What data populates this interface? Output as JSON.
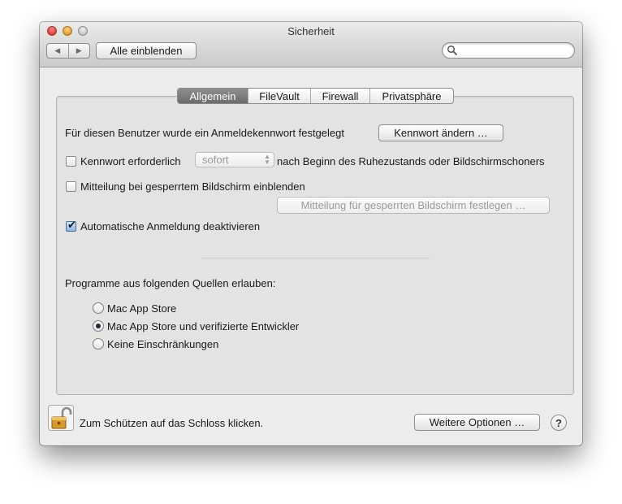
{
  "window": {
    "title": "Sicherheit",
    "show_all_label": "Alle einblenden",
    "search_placeholder": ""
  },
  "tabs": [
    {
      "label": "Allgemein",
      "active": true
    },
    {
      "label": "FileVault",
      "active": false
    },
    {
      "label": "Firewall",
      "active": false
    },
    {
      "label": "Privatsphäre",
      "active": false
    }
  ],
  "general": {
    "password_set_text": "Für diesen Benutzer wurde ein Anmeldekennwort festgelegt",
    "change_password_button": "Kennwort ändern …",
    "require_password_label": "Kennwort erforderlich",
    "require_password_checked": false,
    "require_password_delay": "sofort",
    "require_password_suffix": "nach Beginn des Ruhezustands oder Bildschirmschoners",
    "show_message_label": "Mitteilung bei gesperrtem Bildschirm einblenden",
    "show_message_checked": false,
    "set_message_button": "Mitteilung für gesperrten Bildschirm festlegen …",
    "disable_autologin_label": "Automatische Anmeldung deaktivieren",
    "disable_autologin_checked": true
  },
  "gatekeeper": {
    "heading": "Programme aus folgenden Quellen erlauben:",
    "options": [
      {
        "label": "Mac App Store",
        "selected": false
      },
      {
        "label": "Mac App Store und verifizierte Entwickler",
        "selected": true
      },
      {
        "label": "Keine Einschränkungen",
        "selected": false
      }
    ]
  },
  "footer": {
    "lock_text": "Zum Schützen auf das Schloss klicken.",
    "advanced_button": "Weitere Optionen …",
    "help_label": "?"
  },
  "icons": {
    "back": "back-arrow-icon",
    "forward": "forward-arrow-icon",
    "search": "search-icon",
    "lock": "open-lock-icon",
    "help": "help-icon"
  }
}
